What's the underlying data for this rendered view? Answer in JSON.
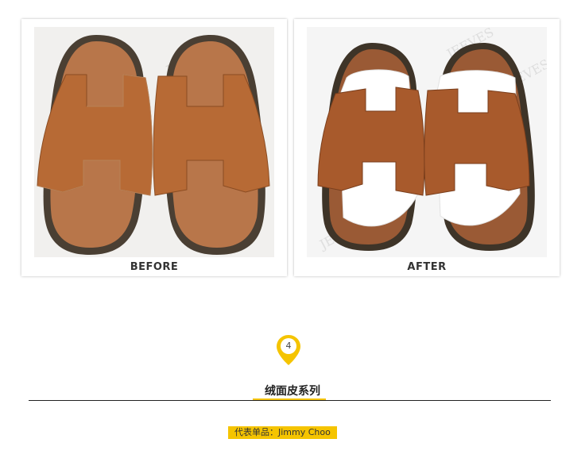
{
  "comparison": {
    "before_label": "BEFORE",
    "after_label": "AFTER",
    "watermark": "JEEVES"
  },
  "section": {
    "number": "4",
    "title": "绒面皮系列",
    "representative": "代表单品：Jimmy Choo"
  },
  "colors": {
    "accent": "#f5c400",
    "rule": "#222222",
    "leather_before": "#b76a35",
    "leather_after": "#a85a2c",
    "footbed": "#b8764a",
    "sole": "#4a3f33"
  },
  "icons": {
    "badge": "map-pin-icon"
  }
}
